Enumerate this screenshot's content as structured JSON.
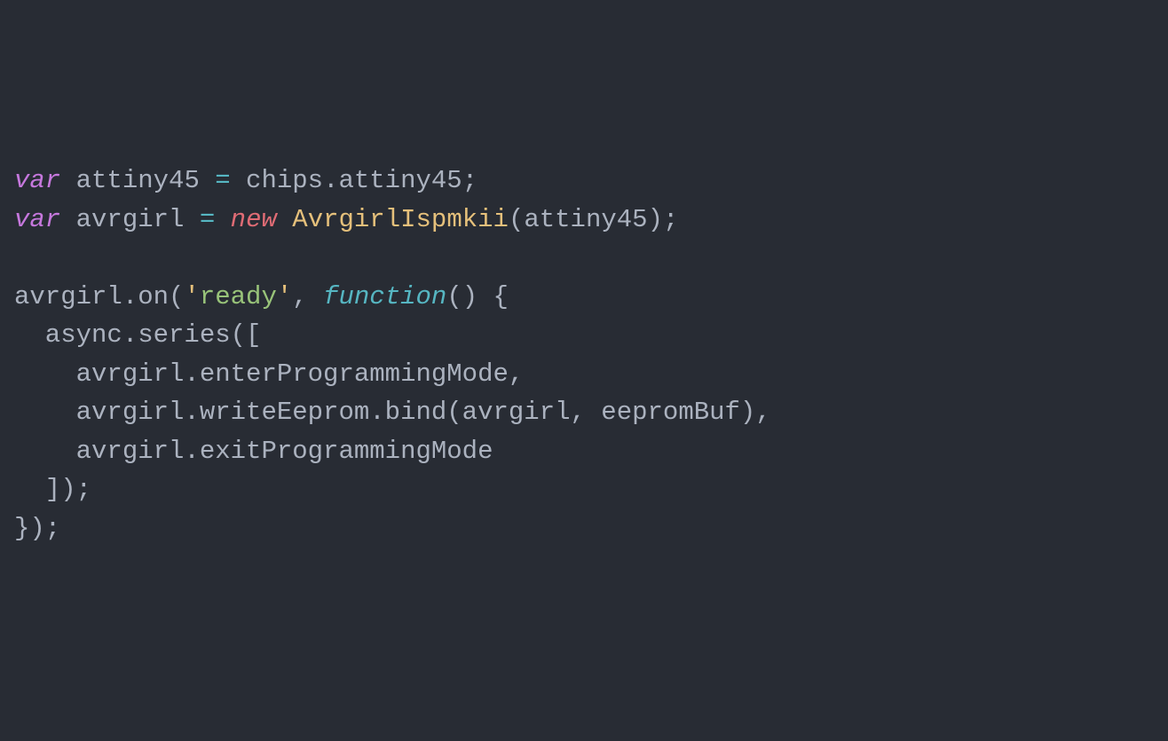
{
  "code": {
    "lines": [
      {
        "tokens": [
          {
            "text": "var",
            "class": "keyword"
          },
          {
            "text": " attiny45 ",
            "class": "variable"
          },
          {
            "text": "=",
            "class": "operator"
          },
          {
            "text": " chips.attiny45;",
            "class": "variable"
          }
        ]
      },
      {
        "tokens": [
          {
            "text": "var",
            "class": "keyword"
          },
          {
            "text": " avrgirl ",
            "class": "variable"
          },
          {
            "text": "=",
            "class": "operator"
          },
          {
            "text": " ",
            "class": "variable"
          },
          {
            "text": "new",
            "class": "operator-new"
          },
          {
            "text": " ",
            "class": "variable"
          },
          {
            "text": "AvrgirlIspmkii",
            "class": "class-name"
          },
          {
            "text": "(attiny45);",
            "class": "variable"
          }
        ]
      },
      {
        "tokens": [
          {
            "text": "",
            "class": "variable"
          }
        ]
      },
      {
        "tokens": [
          {
            "text": "avrgirl.on(",
            "class": "variable"
          },
          {
            "text": "'",
            "class": "string-quote"
          },
          {
            "text": "ready",
            "class": "string"
          },
          {
            "text": "'",
            "class": "string-quote"
          },
          {
            "text": ", ",
            "class": "variable"
          },
          {
            "text": "function",
            "class": "function-keyword"
          },
          {
            "text": "() {",
            "class": "variable"
          }
        ]
      },
      {
        "tokens": [
          {
            "text": "  async.series([",
            "class": "variable"
          }
        ]
      },
      {
        "tokens": [
          {
            "text": "    avrgirl.enterProgrammingMode,",
            "class": "variable"
          }
        ]
      },
      {
        "tokens": [
          {
            "text": "    avrgirl.writeEeprom.bind(avrgirl, eepromBuf),",
            "class": "variable"
          }
        ]
      },
      {
        "tokens": [
          {
            "text": "    avrgirl.exitProgrammingMode",
            "class": "variable"
          }
        ]
      },
      {
        "tokens": [
          {
            "text": "  ]);",
            "class": "variable"
          }
        ]
      },
      {
        "tokens": [
          {
            "text": "});",
            "class": "variable"
          }
        ]
      }
    ]
  }
}
